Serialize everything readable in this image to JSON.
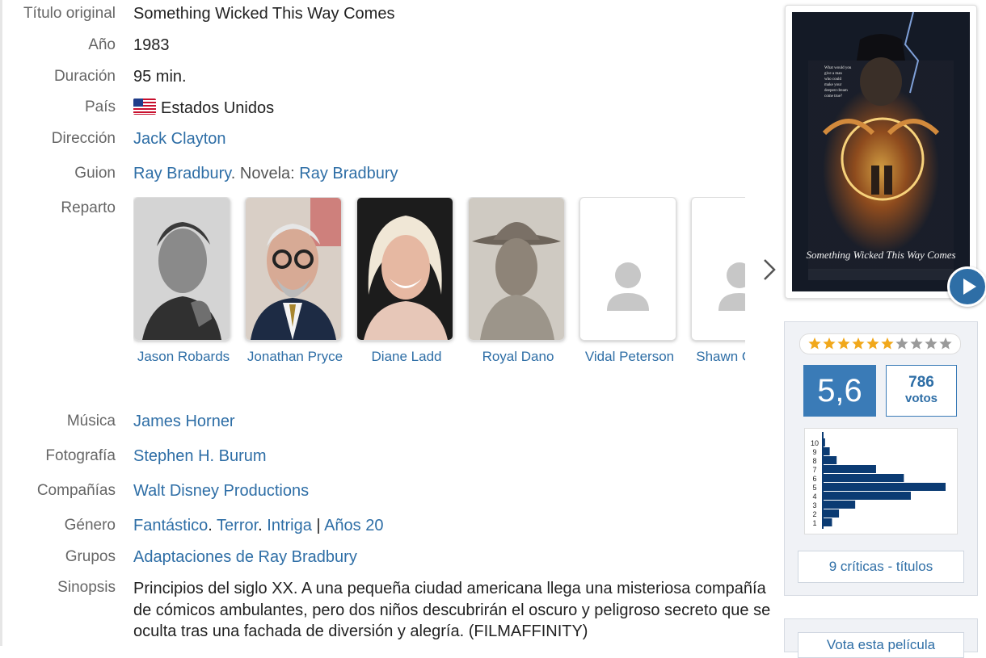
{
  "details": [
    {
      "label": "Título original",
      "value": "Something Wicked This Way Comes"
    },
    {
      "label": "Año",
      "value": "1983"
    },
    {
      "label": "Duración",
      "value": "95 min."
    },
    {
      "label": "País",
      "value": "Estados Unidos",
      "icon": "us-flag-icon"
    },
    {
      "label": "Dirección",
      "value": "Jack Clayton"
    },
    {
      "label": "Guion",
      "link1": "Ray Bradbury",
      "mid": ". Novela: ",
      "link2": "Ray Bradbury"
    },
    {
      "label": "Reparto"
    },
    {
      "label": "Música",
      "value": "James Horner"
    },
    {
      "label": "Fotografía",
      "value": "Stephen H. Burum"
    },
    {
      "label": "Compañías",
      "value": "Walt Disney Productions"
    },
    {
      "label": "Género",
      "g1": "Fantástico",
      "g2": "Terror",
      "g3": "Intriga",
      "g4": "Años 20"
    },
    {
      "label": "Grupos",
      "value": "Adaptaciones de Ray Bradbury"
    },
    {
      "label": "Sinopsis",
      "value": "Principios del siglo XX. A una pequeña ciudad americana llega una misteriosa compañía de cómicos ambulantes, pero dos niños descubrirán el oscuro y peligroso secreto que se oculta tras una fachada de diversión y alegría. (FILMAFFINITY)"
    }
  ],
  "cast": [
    {
      "name": "Jason Robards",
      "photo": "actor-photo"
    },
    {
      "name": "Jonathan Pryce",
      "photo": "actor-photo"
    },
    {
      "name": "Diane Ladd",
      "photo": "actor-photo"
    },
    {
      "name": "Royal Dano",
      "photo": "actor-photo"
    },
    {
      "name": "Vidal Peterson",
      "photo": "placeholder-avatar-icon"
    },
    {
      "name": "Shawn Carson",
      "photo": "placeholder-avatar-icon"
    }
  ],
  "poster": {
    "tagline": "What would you give a man who could make your deepest dream come true?",
    "title_art": "Something Wicked This Way Comes"
  },
  "rating": {
    "average": "5,6",
    "votes": "786",
    "votes_label": "votos",
    "stars_fraction": 0.56,
    "histogram": {
      "labels": [
        "10",
        "9",
        "8",
        "7",
        "6",
        "5",
        "4",
        "3",
        "2",
        "1"
      ],
      "values": [
        1,
        3,
        6,
        23,
        35,
        53,
        38,
        14,
        7,
        4
      ]
    },
    "critics_button": "9 críticas - títulos"
  },
  "vote_button": "Vota esta película",
  "colors": {
    "link": "#2e6ea6",
    "accent": "#3a7bb7",
    "histogram": "#0b3b73"
  }
}
